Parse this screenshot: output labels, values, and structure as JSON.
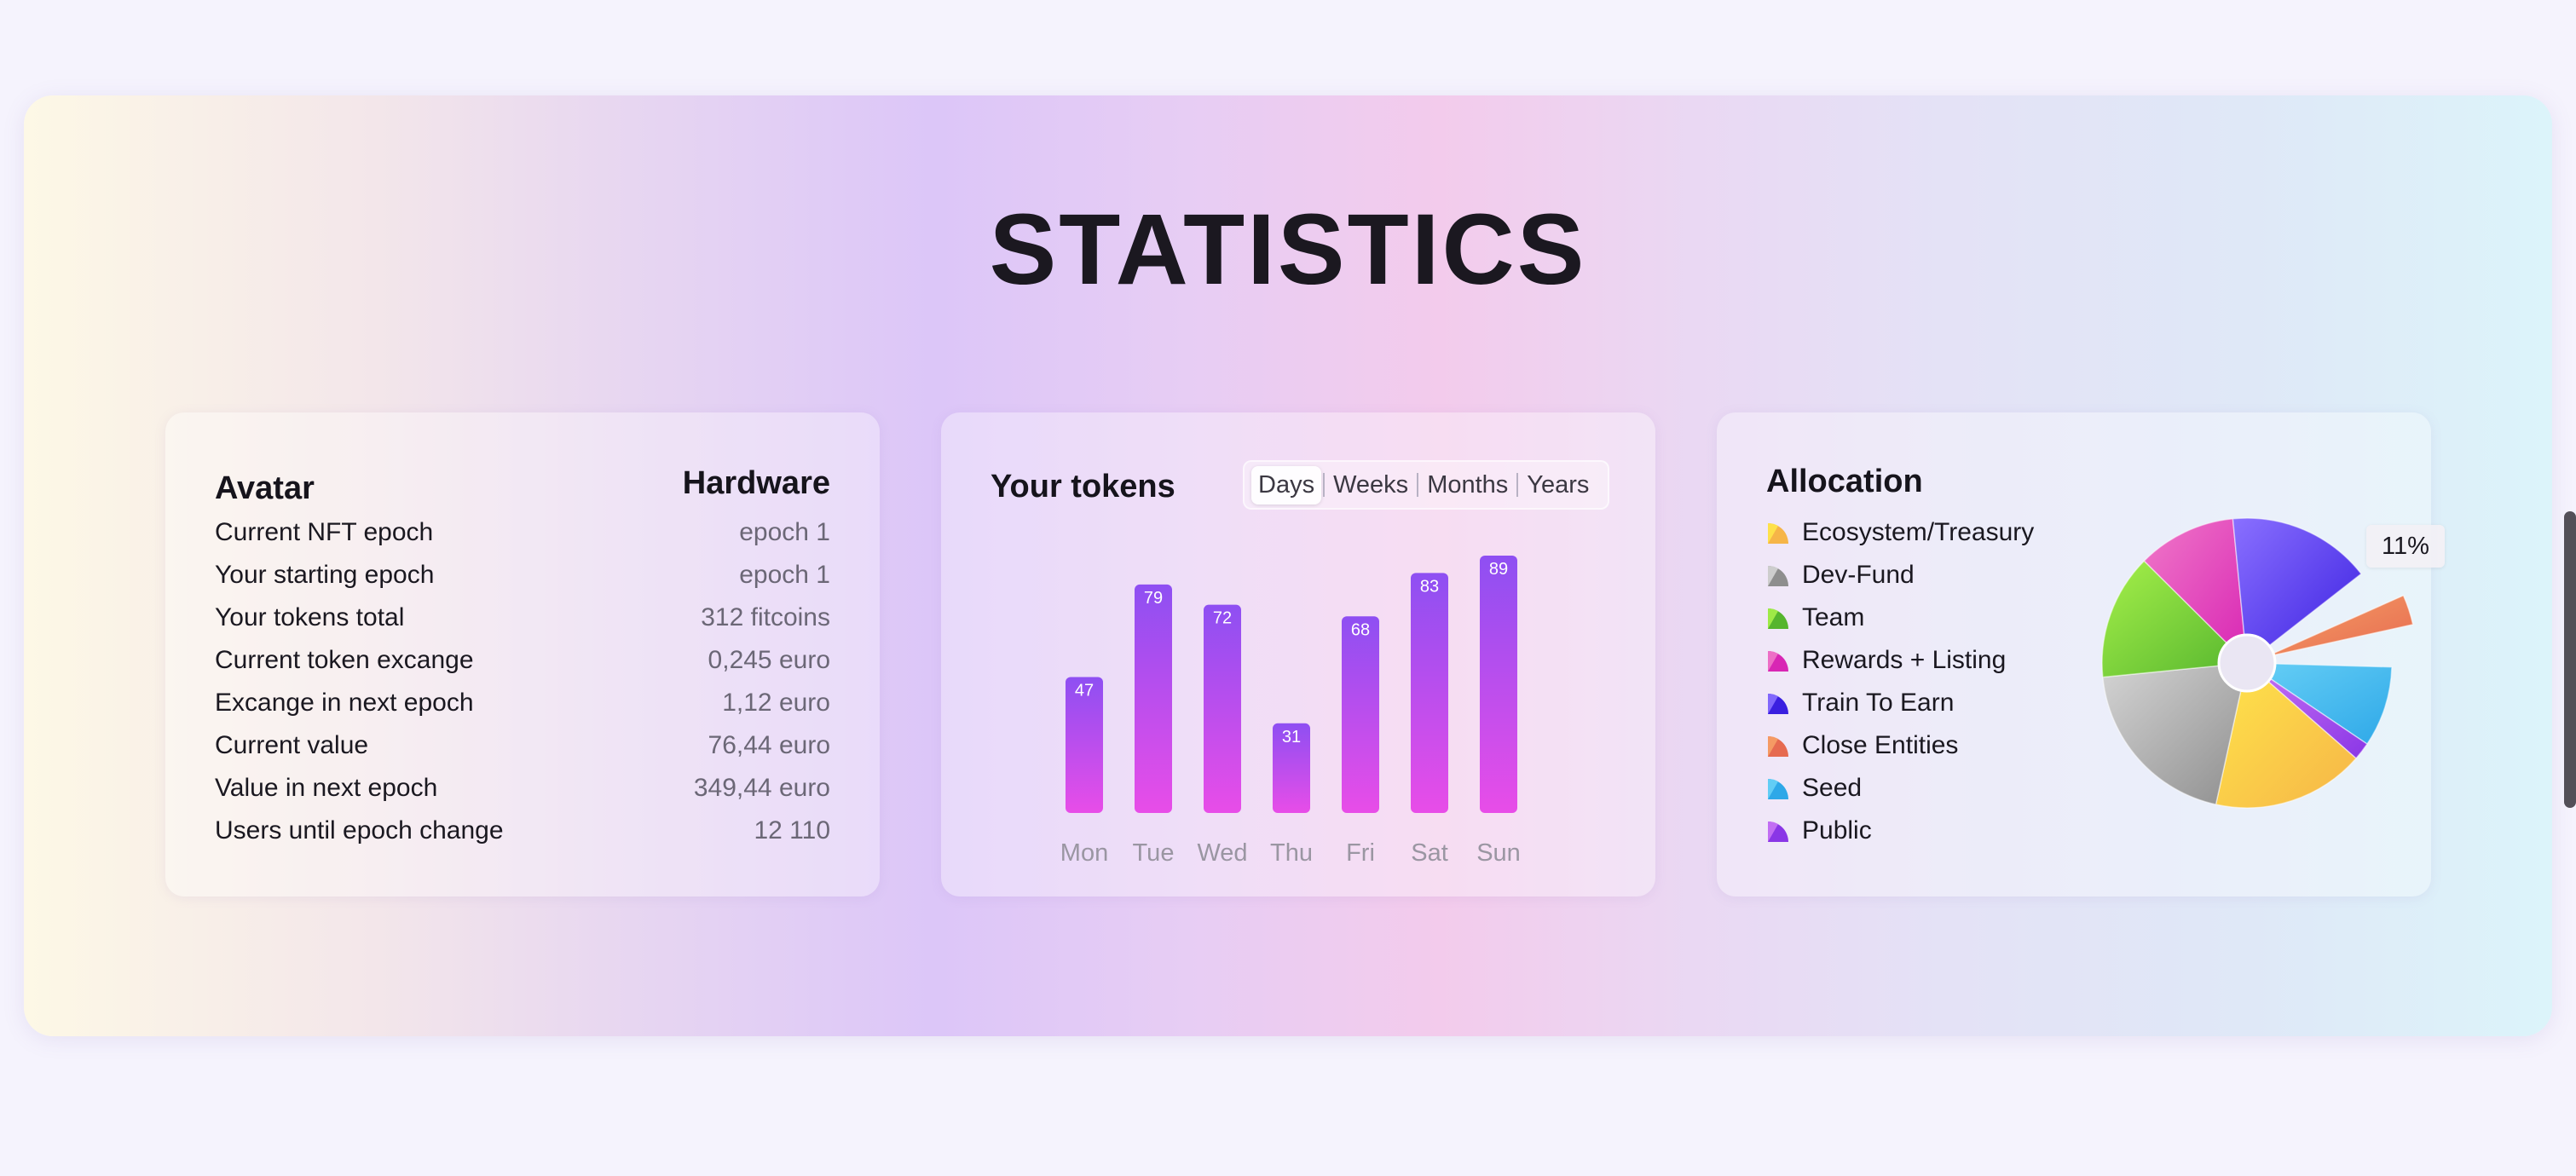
{
  "page": {
    "title": "STATISTICS"
  },
  "avatar_card": {
    "left_heading": "Avatar",
    "right_heading": "Hardware",
    "rows": [
      {
        "label": "Current NFT epoch",
        "value": "epoch 1"
      },
      {
        "label": "Your starting epoch",
        "value": "epoch 1"
      },
      {
        "label": "Your tokens total",
        "value": "312 fitcoins"
      },
      {
        "label": "Current token excange",
        "value": "0,245 euro"
      },
      {
        "label": "Excange in next epoch",
        "value": "1,12 euro"
      },
      {
        "label": "Current value",
        "value": "76,44 euro"
      },
      {
        "label": "Value in next epoch",
        "value": "349,44 euro"
      },
      {
        "label": "Users until epoch change",
        "value": "12 110"
      }
    ]
  },
  "tokens_card": {
    "title": "Your tokens",
    "periods": [
      "Days",
      "Weeks",
      "Months",
      "Years"
    ],
    "active_period": "Days"
  },
  "allocation_card": {
    "title": "Allocation",
    "highlight_label": "11%"
  },
  "colors": {
    "bar_top": "#8e4ff2",
    "bar_bottom": "#e84de8"
  },
  "chart_data": [
    {
      "type": "bar",
      "categories": [
        "Mon",
        "Tue",
        "Wed",
        "Thu",
        "Fri",
        "Sat",
        "Sun"
      ],
      "values": [
        47,
        79,
        72,
        31,
        68,
        83,
        89
      ],
      "ylim": [
        0,
        89
      ],
      "grid": false,
      "data_labels": true
    },
    {
      "type": "pie",
      "labels": [
        "Ecosystem/Treasury",
        "Dev-Fund",
        "Team",
        "Rewards + Listing",
        "Train To Earn",
        "Close Entities",
        "Seed",
        "Public"
      ],
      "values": [
        17,
        20,
        14,
        11,
        16,
        11,
        9,
        2
      ],
      "highlighted": "Close Entities",
      "legend": "left",
      "colors": [
        [
          "#ffe54a",
          "#f6b548"
        ],
        [
          "#d4d4d4",
          "#8e8e8e"
        ],
        [
          "#a6f04a",
          "#55b52e"
        ],
        [
          "#f078c8",
          "#d826b4"
        ],
        [
          "#8a70ff",
          "#3a1fe0"
        ],
        [
          "#f6a066",
          "#e66a50"
        ],
        [
          "#68d0f6",
          "#2ea8e8"
        ],
        [
          "#c874f4",
          "#8a36e6"
        ]
      ]
    }
  ]
}
